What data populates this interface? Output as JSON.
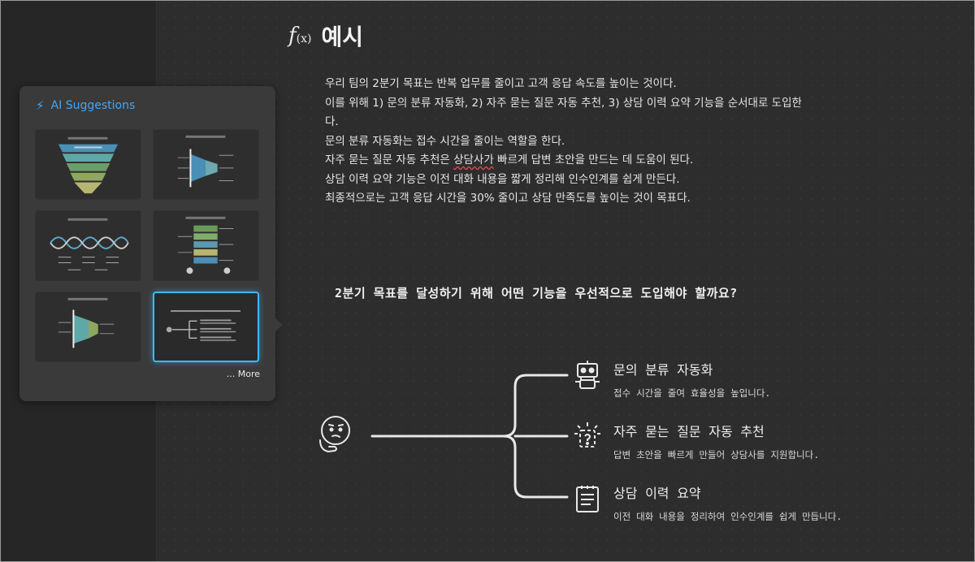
{
  "header": {
    "fx_label": "f",
    "fx_sub": "(x)",
    "title": "예시"
  },
  "paragraphs": [
    "우리 팀의 2분기 목표는 반복 업무를 줄이고 고객 응답 속도를 높이는 것이다.",
    "이를 위해 1) 문의 분류 자동화, 2) 자주 묻는 질문 자동 추천, 3) 상담 이력 요약 기능을 순서대로 도입한",
    "다.",
    "문의 분류 자동화는 접수 시간을 줄이는 역할을 한다.",
    {
      "before": "자주 묻는 질문 자동 추천은 ",
      "flagged": "상담사가",
      "after": " 빠르게 답변 초안을 만드는 데 도움이 된다."
    },
    "상담 이력 요약 기능은 이전 대화 내용을 짧게 정리해 인수인계를 쉽게 만든다.",
    "최종적으로는 고객 응답 시간을 30% 줄이고 상담 만족도를 높이는 것이 목표다."
  ],
  "question": "2분기 목표를 달성하기 위해 어떤 기능을 우선적으로 도입해야 할까요?",
  "diagram": {
    "root_icon": "thinking-face-icon",
    "branches": [
      {
        "title": "문의 분류 자동화",
        "desc": "접수 시간을 줄여 효율성을 높입니다.",
        "icon": "robot-icon"
      },
      {
        "title": "자주 묻는 질문 자동 추천",
        "desc": "답변 초안을 빠르게 만들어 상담사를 지원합니다.",
        "icon": "question-bulb-icon"
      },
      {
        "title": "상담 이력 요약",
        "desc": "이전 대화 내용을 정리하여 인수인계를 쉽게 만듭니다.",
        "icon": "document-list-icon"
      }
    ]
  },
  "ai_panel": {
    "title": "AI Suggestions",
    "icon": "lightning-icon",
    "more_label": "... More",
    "thumbnails": [
      {
        "name": "inverted-pyramid-template",
        "selected": false
      },
      {
        "name": "horizontal-funnel-template",
        "selected": false
      },
      {
        "name": "dna-helix-template",
        "selected": false
      },
      {
        "name": "stacked-blocks-template",
        "selected": false
      },
      {
        "name": "side-funnel-template",
        "selected": false
      },
      {
        "name": "tree-branch-template",
        "selected": true
      }
    ]
  },
  "colors": {
    "accent": "#3da8ff",
    "selected_border": "#3db9ff",
    "spell_underline": "#e04a4a",
    "background": "#2d2d2d"
  }
}
